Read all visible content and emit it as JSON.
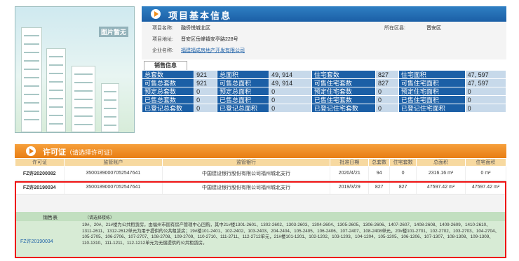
{
  "project": {
    "photo_placeholder": "图片暂无",
    "section_title": "项目基本信息",
    "fields": [
      {
        "label": "项目名称:",
        "value": "融侨悦城北区"
      },
      {
        "label": "项目地址:",
        "value": "晋安区岳峰镇安亭路228号"
      },
      {
        "label": "企业名称:",
        "value": "福建福成房地产开发有限公司"
      }
    ],
    "region_label": "所在区县:",
    "region_value": "晋安区"
  },
  "sales_info": {
    "tab_label": "销售信息",
    "rows": [
      [
        "总套数",
        "921",
        "总面积",
        "49, 914",
        "住宅套数",
        "827",
        "住宅面积",
        "47, 597"
      ],
      [
        "可售总套数",
        "921",
        "可售总面积",
        "49, 914",
        "可售住宅套数",
        "827",
        "可售住宅面积",
        "47, 597"
      ],
      [
        "预定总套数",
        "0",
        "预定总面积",
        "0",
        "预定住宅套数",
        "0",
        "预定住宅面积",
        "0"
      ],
      [
        "已售总套数",
        "0",
        "已售总面积",
        "0",
        "已售住宅套数",
        "0",
        "已售住宅面积",
        "0"
      ],
      [
        "已登记总套数",
        "0",
        "已登记总面积",
        "0",
        "已登记住宅套数",
        "0",
        "已登记住宅面积",
        "0"
      ]
    ]
  },
  "permit": {
    "title": "许可证",
    "subtitle": "（请选择许可证）",
    "headers": [
      "许可证",
      "监管账户",
      "监管银行",
      "批准日期",
      "总套数",
      "住宅套数",
      "总面积",
      "住宅面积"
    ],
    "rows": [
      [
        "FZ许20200082",
        "35001890007052547641",
        "中国建设银行股份有限公司福州城北支行",
        "2020/4/21",
        "94",
        "0",
        "2316.16 m²",
        "0 m²"
      ],
      [
        "FZ许20190034",
        "35001890007052547641",
        "中国建设银行股份有限公司福州城北支行",
        "2019/3/29",
        "827",
        "827",
        "47597.42 m²",
        "47597.42 m²"
      ]
    ],
    "sales_table_label": "销售表",
    "building_hint": "（请选择楼栋）",
    "selected_permit_id": "FZ许20190034",
    "description": "19#、20#、21#楼为公共租赁房，由福州市国有房产管理中心回购，其中21#楼1301-2601、1302-2602、1303-2603、1304-2604、1305-2605、1306-2606、1407-2607、1408-2608、1409-2609、1410-2610、1311-2611、1312-2612单元为用于提供的公共租赁房；19#楼101-2401、102-2402、103-2403、204-2404、105-2405、106-2406、107-2407、108-2408单元，20#楼101-2701、102-2702、103-2703、104-2704、105-2705、106-2706、107-2707、108-2708、109-2709、110-2710、111-2711、112-2712单元，21#楼101-1201、102-1202、103-1203、104-1204、105-1205、106-1206、107-1307、108-1308、109-1309、110-1310、111-1211、112-1212单元为无偿提供的公共租赁房。"
  },
  "colors": {
    "blue": "#1b5fa6",
    "orange": "#e87d12",
    "red_border": "#e11",
    "green": "#d7ebd5"
  }
}
